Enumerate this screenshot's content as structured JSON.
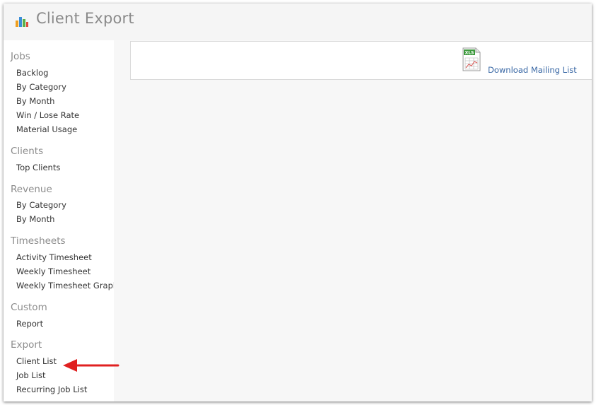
{
  "header": {
    "title": "Client Export",
    "icon": "bar-chart-icon"
  },
  "sidebar": {
    "sections": [
      {
        "title": "Jobs",
        "items": [
          "Backlog",
          "By Category",
          "By Month",
          "Win / Lose Rate",
          "Material Usage"
        ]
      },
      {
        "title": "Clients",
        "items": [
          "Top Clients"
        ]
      },
      {
        "title": "Revenue",
        "items": [
          "By Category",
          "By Month"
        ]
      },
      {
        "title": "Timesheets",
        "items": [
          "Activity Timesheet",
          "Weekly Timesheet",
          "Weekly Timesheet Graph"
        ]
      },
      {
        "title": "Custom",
        "items": [
          "Report"
        ]
      },
      {
        "title": "Export",
        "items": [
          "Client List",
          "Job List",
          "Recurring Job List"
        ]
      }
    ]
  },
  "main": {
    "download": {
      "icon_label": "XLS",
      "label": "Download Mailing List"
    }
  },
  "colors": {
    "arrow": "#e02020",
    "link": "#3c6aa6",
    "section_title": "#8c8c8c"
  }
}
